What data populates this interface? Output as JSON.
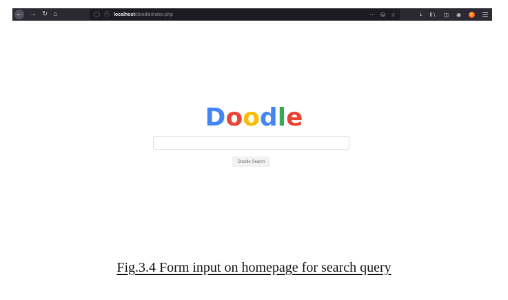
{
  "browser": {
    "url_host": "localhost",
    "url_path": "/doodle/index.php",
    "icons": {
      "back": "arrow-left",
      "forward": "arrow-right",
      "reload": "reload",
      "home": "home",
      "tracking": "shield",
      "info": "info",
      "page_actions": "more",
      "pocket": "pocket",
      "bookmark": "star",
      "downloads": "download",
      "library": "library",
      "sidebar": "sidebar",
      "account": "account",
      "extension": "extension",
      "menu": "hamburger-menu"
    }
  },
  "page": {
    "logo_letters": [
      {
        "char": "D",
        "color": "#4285f4"
      },
      {
        "char": "o",
        "color": "#ea4335"
      },
      {
        "char": "o",
        "color": "#fbbc05"
      },
      {
        "char": "d",
        "color": "#4285f4"
      },
      {
        "char": "l",
        "color": "#34a853"
      },
      {
        "char": "e",
        "color": "#ea4335"
      }
    ],
    "search_value": "",
    "search_button_label": "Doodle Search"
  },
  "caption": "Fig.3.4 Form input on homepage for search query"
}
